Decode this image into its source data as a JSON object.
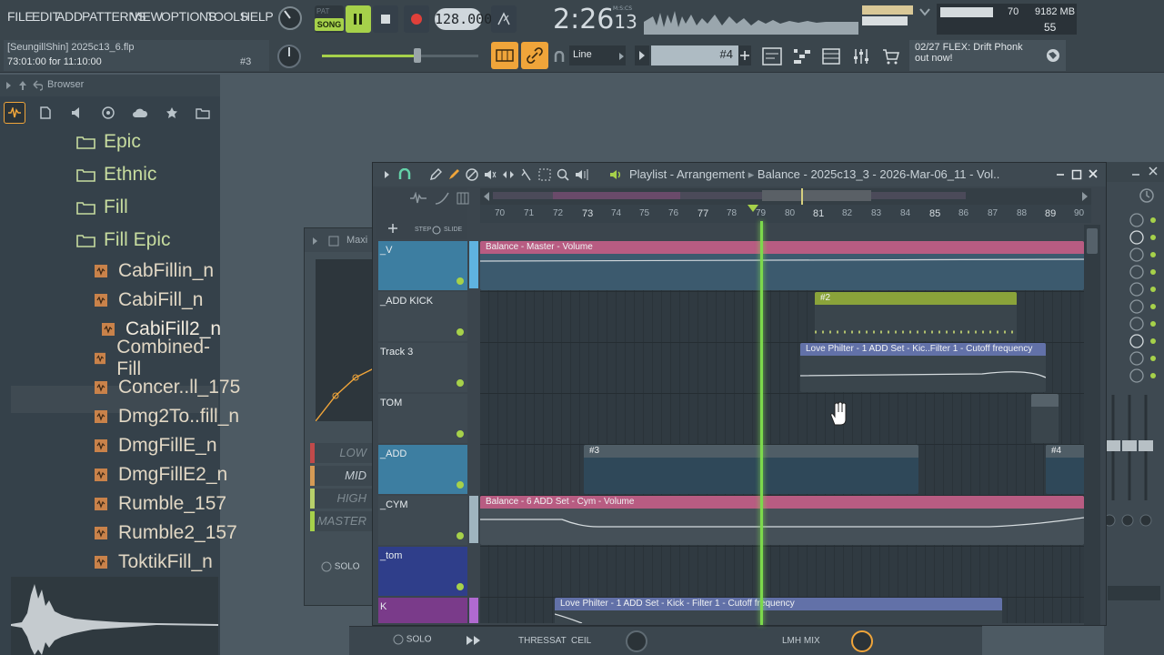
{
  "menu": [
    "FILE",
    "EDIT",
    "ADD",
    "PATTERNS",
    "VIEW",
    "OPTIONS",
    "TOOLS",
    "HELP"
  ],
  "transport": {
    "pat_label": "PAT",
    "song_label": "SONG",
    "tempo": "128.000",
    "time_main": "2:26",
    "time_frac": "13",
    "time_format": "M:S:CS"
  },
  "meters": {
    "cpu": "70",
    "memory": "9182 MB",
    "polyphony": "55"
  },
  "project": {
    "user_file": "[SeungillShin]  2025c13_6.flp",
    "duration": "73:01:00 for 11:10:00",
    "pattern_ref": "#3"
  },
  "toolbar": {
    "snap": "Line",
    "pattern": "#4"
  },
  "news": {
    "line1": "02/27  FLEX: Drift Phonk",
    "line2": "out now!"
  },
  "browser": {
    "title": "Browser",
    "folders": [
      "Epic",
      "Ethnic",
      "Fill",
      "Fill Epic"
    ],
    "files": [
      "CabFillin_n",
      "CabiFill_n",
      "CabiFill2_n",
      "Combined-Fill",
      "Concer..ll_175",
      "Dmg2To..fill_n",
      "DmgFillE_n",
      "DmgFillE2_n",
      "Rumble_157",
      "Rumble2_157",
      "ToktikFill_n"
    ],
    "selected_file": "CabiFill2_n"
  },
  "maximus": {
    "title": "Maxi",
    "bands": [
      "LOW",
      "MID",
      "HIGH",
      "MASTER"
    ],
    "solo": "SOLO"
  },
  "playlist": {
    "title": "Playlist - Arrangement",
    "breadcrumb": "Balance - 2025c13_3 - 2026-Mar-06_11 - Vol..",
    "step_label": "STEP",
    "slide_label": "SLIDE",
    "ruler": [
      "70",
      "71",
      "72",
      "73",
      "74",
      "75",
      "76",
      "77",
      "78",
      "79",
      "80",
      "81",
      "82",
      "83",
      "84",
      "85",
      "86",
      "87",
      "88",
      "89",
      "90"
    ],
    "tracks": [
      {
        "name": "_V",
        "color": "#3d7ea1"
      },
      {
        "name": "_ADD KICK",
        "color": "#3a454c"
      },
      {
        "name": "Track 3",
        "color": "#3a454c"
      },
      {
        "name": "TOM",
        "color": "#3a454c"
      },
      {
        "name": "_ADD",
        "color": "#3d7ea1"
      },
      {
        "name": "_CYM",
        "color": "#3a454c"
      },
      {
        "name": "_tom",
        "color": "#2f3e8a"
      },
      {
        "name": "K",
        "color": "#7a3b8a"
      }
    ],
    "clips": [
      {
        "label": "Balance - Master - Volume"
      },
      {
        "label": "#2"
      },
      {
        "label": "Love Philter - 1 ADD Set - Kic..Filter 1 - Cutoff frequency"
      },
      {
        "label": "#3"
      },
      {
        "label": "#4"
      },
      {
        "label": "Balance - 6 ADD Set - Cym - Volume"
      },
      {
        "label": "Love Philter - 1 ADD Set - Kick - Filter 1 - Cutoff frequency"
      }
    ]
  },
  "bottom": {
    "solo": "SOLO",
    "thres": "THRES",
    "sat": "SAT",
    "ceil": "CEIL",
    "lmh": "LMH MIX"
  },
  "colors": {
    "accent_green": "#a6d14a",
    "playhead": "#7cd94c",
    "orange": "#f0a53a"
  }
}
